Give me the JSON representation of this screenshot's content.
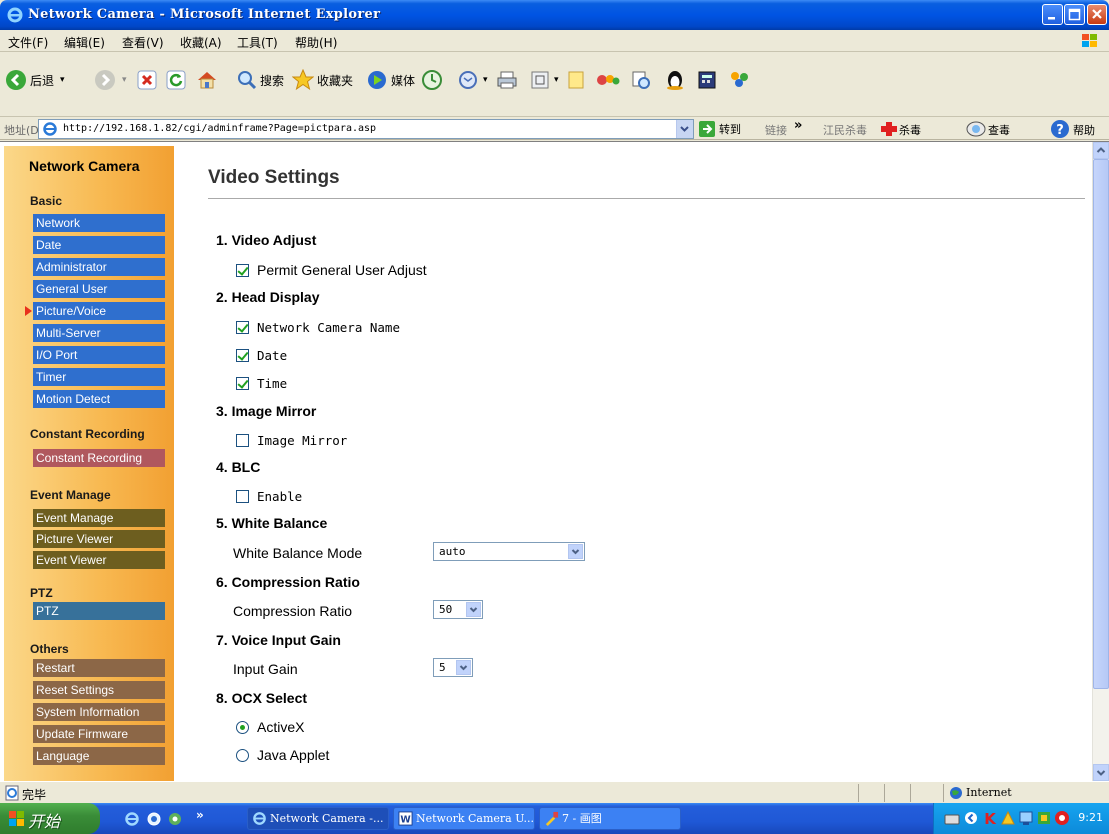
{
  "window": {
    "title": "Network Camera - Microsoft Internet Explorer",
    "colors": {
      "titlebar": "#0054e3",
      "taskbar": "#245edb",
      "start": "#3a8d38"
    }
  },
  "menu": {
    "items": [
      "文件(F)",
      "编辑(E)",
      "查看(V)",
      "收藏(A)",
      "工具(T)",
      "帮助(H)"
    ]
  },
  "toolbar": {
    "back": "后退",
    "search": "搜索",
    "favorites": "收藏夹",
    "media": "媒体"
  },
  "address": {
    "label": "地址(D)",
    "url": "http://192.168.1.82/cgi/adminframe?Page=pictpara.asp",
    "go": "转到",
    "links": "链接",
    "links_more": "»",
    "antivirus": "江民杀毒",
    "kill": "杀毒",
    "scan": "查毒",
    "help": "帮助"
  },
  "sidebar": {
    "title": "Network Camera",
    "groups": [
      {
        "heading": "Basic",
        "items": [
          "Network",
          "Date",
          "Administrator",
          "General User",
          "Picture/Voice",
          "Multi-Server",
          "I/O Port",
          "Timer",
          "Motion Detect"
        ]
      },
      {
        "heading": "Constant Recording",
        "items": [
          "Constant Recording"
        ]
      },
      {
        "heading": "Event Manage",
        "items": [
          "Event Manage",
          "Picture Viewer",
          "Event Viewer"
        ]
      },
      {
        "heading": "PTZ",
        "items": [
          "PTZ"
        ]
      },
      {
        "heading": "Others",
        "items": [
          "Restart",
          "Reset Settings",
          "System Information",
          "Update Firmware",
          "Language"
        ]
      }
    ],
    "active_item": "Picture/Voice"
  },
  "main": {
    "title": "Video Settings",
    "sections": {
      "video_adjust": {
        "heading": "1. Video Adjust",
        "permit_label": "Permit General User Adjust",
        "permit_checked": true
      },
      "head_display": {
        "heading": "2. Head Display",
        "camera_name_label": "Network Camera Name",
        "camera_name_checked": true,
        "date_label": "Date",
        "date_checked": true,
        "time_label": "Time",
        "time_checked": true
      },
      "image_mirror": {
        "heading": "3. Image Mirror",
        "label": "Image Mirror",
        "checked": false
      },
      "blc": {
        "heading": "4. BLC",
        "label": "Enable",
        "checked": false
      },
      "white_balance": {
        "heading": "5. White Balance",
        "label": "White Balance Mode",
        "value": "auto"
      },
      "compression": {
        "heading": "6. Compression Ratio",
        "label": "Compression Ratio",
        "value": "50"
      },
      "voice_gain": {
        "heading": "7. Voice Input Gain",
        "label": "Input Gain",
        "value": "5"
      },
      "ocx": {
        "heading": "8. OCX Select",
        "activex_label": "ActiveX",
        "java_label": "Java Applet",
        "selected": "ActiveX"
      }
    }
  },
  "status": {
    "text": "完毕",
    "zone": "Internet"
  },
  "taskbar": {
    "start": "开始",
    "tasks": [
      "Network Camera -...",
      "Network Camera U...",
      "7 - 画图"
    ],
    "clock": "9:21"
  }
}
